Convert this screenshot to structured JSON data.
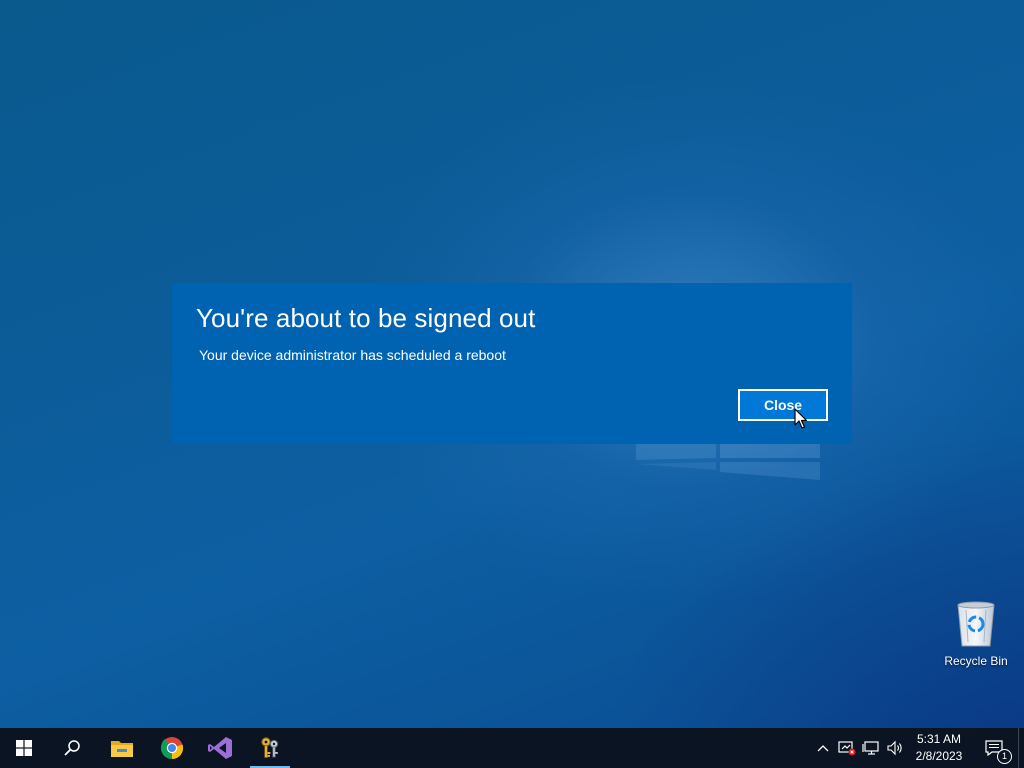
{
  "dialog": {
    "title": "You're about to be signed out",
    "message": "Your device administrator has scheduled a reboot",
    "close_label": "Close"
  },
  "desktop": {
    "recycle_bin_label": "Recycle Bin"
  },
  "taskbar": {
    "pinned": [
      {
        "name": "File Explorer",
        "icon": "folder-icon"
      },
      {
        "name": "Google Chrome",
        "icon": "chrome-icon"
      },
      {
        "name": "Visual Studio",
        "icon": "visual-studio-icon"
      },
      {
        "name": "Credentials app",
        "icon": "keys-icon",
        "active": true
      }
    ],
    "clock": {
      "time": "5:31 AM",
      "date": "2/8/2023"
    },
    "notification_count": "1"
  },
  "colors": {
    "dialog_background": "#0063b1",
    "button_background": "#0078d7",
    "taskbar_background": "#0a1422",
    "active_indicator": "#76b9ed"
  }
}
